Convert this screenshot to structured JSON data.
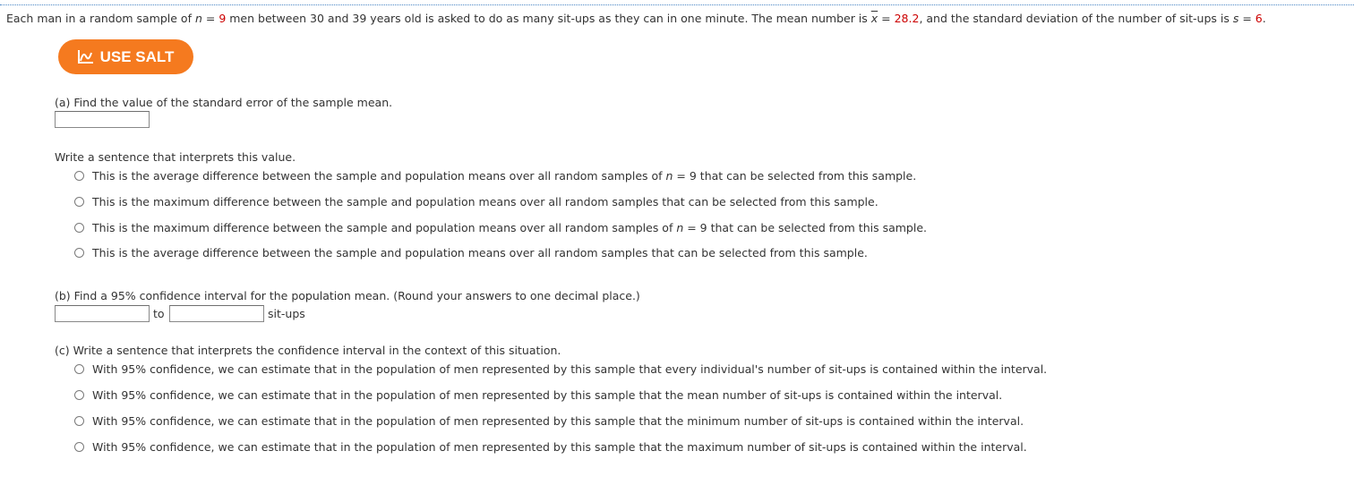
{
  "intro": {
    "prefix": "Each man in a random sample of ",
    "n_sym": "n",
    "eq1": " = ",
    "n_val": "9",
    "middle": " men between 30 and 39 years old is asked to do as many sit-ups as they can in one minute. The mean number is ",
    "x_sym": "x",
    "eq2": " = ",
    "x_val": "28.2",
    "after_x": ", and the standard deviation of the number of sit-ups is ",
    "s_sym": "s",
    "eq3": " = ",
    "s_val": "6",
    "end": "."
  },
  "salt_button": {
    "label": "USE SALT",
    "icon": "chart-line-icon"
  },
  "part_a": {
    "question": "(a) Find the value of the standard error of the sample mean.",
    "interpret_prompt": "Write a sentence that interprets this value.",
    "options": [
      {
        "text": "This is the average difference between the sample and population means over all random samples of ",
        "n": "n",
        "tail": " = 9 that can be selected from this sample."
      },
      {
        "text": "This is the maximum difference between the sample and population means over all random samples that can be selected from this sample.",
        "n": "",
        "tail": ""
      },
      {
        "text": "This is the maximum difference between the sample and population means over all random samples of ",
        "n": "n",
        "tail": " = 9 that can be selected from this sample."
      },
      {
        "text": "This is the average difference between the sample and population means over all random samples that can be selected from this sample.",
        "n": "",
        "tail": ""
      }
    ]
  },
  "part_b": {
    "question": "(b) Find a 95% confidence interval for the population mean. (Round your answers to one decimal place.)",
    "to_label": "to",
    "unit_label": "sit-ups"
  },
  "part_c": {
    "question": "(c) Write a sentence that interprets the confidence interval in the context of this situation.",
    "options": [
      "With 95% confidence, we can estimate that in the population of men represented by this sample that every individual's number of sit-ups is contained within the interval.",
      "With 95% confidence, we can estimate that in the population of men represented by this sample that the mean number of sit-ups is contained within the interval.",
      "With 95% confidence, we can estimate that in the population of men represented by this sample that the minimum number of sit-ups is contained within the interval.",
      "With 95% confidence, we can estimate that in the population of men represented by this sample that the maximum number of sit-ups is contained within the interval."
    ]
  },
  "colors": {
    "accent": "#f57a1f",
    "highlight": "#cc0000"
  }
}
